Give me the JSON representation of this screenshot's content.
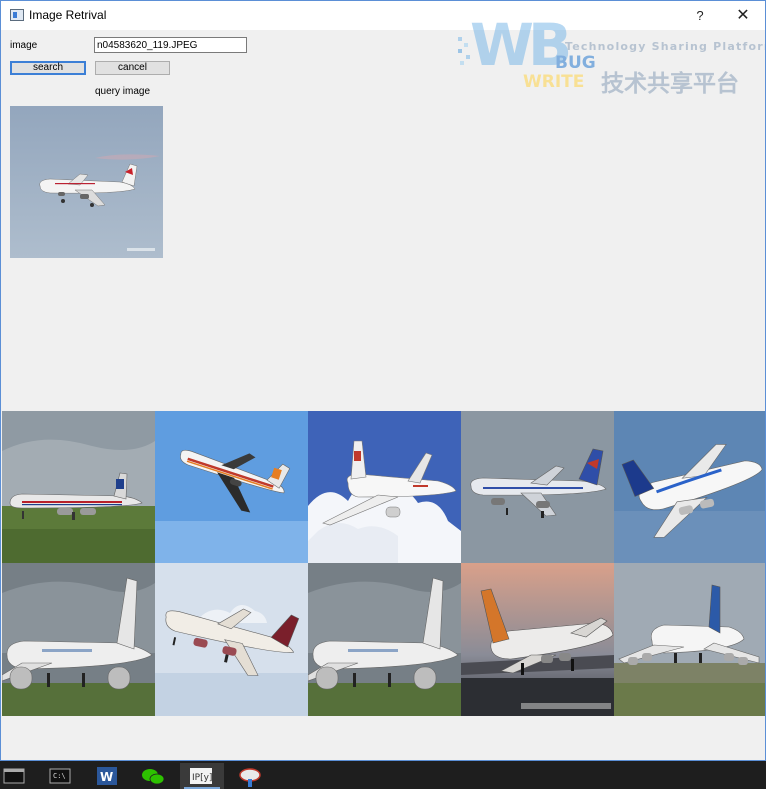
{
  "window": {
    "title": "Image Retrival",
    "help_glyph": "?",
    "close_glyph": "✕"
  },
  "form": {
    "image_label": "image",
    "image_value": "n04583620_119.JPEG",
    "search_label": "search",
    "cancel_label": "cancel",
    "query_label": "query image"
  },
  "watermark": {
    "logo_text": "WB",
    "bug_text": "BUG",
    "write_text": "WRITE",
    "tagline": "Technology Sharing Platform",
    "chinese_text": "技术共享平台"
  },
  "results": [
    "airliner-on-grass-cloudy",
    "airliner-banking-blue-sky",
    "airliner-over-clouds",
    "airliner-grey-sky",
    "airbus-a380-climbing",
    "a340-on-ground-1",
    "airliner-landing-pale-sky",
    "a340-on-ground-2",
    "jumbo-sunset",
    "jumbo-taxiing"
  ],
  "taskbar": {
    "items": [
      "terminal-icon",
      "console-icon",
      "word-icon",
      "wechat-icon",
      "ipython-icon",
      "paint-icon"
    ],
    "active_index": 4
  }
}
